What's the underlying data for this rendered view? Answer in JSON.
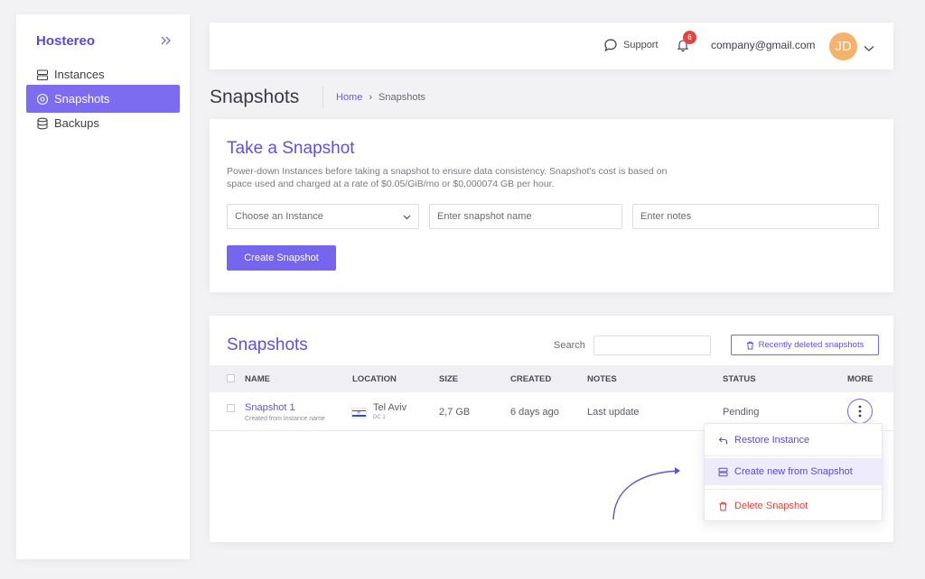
{
  "brand": "Hostereo",
  "sidebar": {
    "items": [
      {
        "label": "Instances",
        "icon": "server-icon",
        "active": false
      },
      {
        "label": "Snapshots",
        "icon": "disc-icon",
        "active": true
      },
      {
        "label": "Backups",
        "icon": "database-icon",
        "active": false
      }
    ]
  },
  "topbar": {
    "support_label": "Support",
    "notifications_count": "6",
    "email": "company@gmail.com",
    "avatar_initials": "JD"
  },
  "page": {
    "title": "Snapshots",
    "breadcrumb": {
      "home": "Home",
      "current": "Snapshots"
    }
  },
  "take_snapshot": {
    "title": "Take a Snapshot",
    "description": "Power-down Instances before taking a snapshot to ensure data consistency. Snapshot's cost is based on space used and charged at a rate of $0.05/GiB/mo or $0,000074 GB per hour.",
    "instance_select": "Choose an Instance",
    "name_placeholder": "Enter snapshot name",
    "notes_placeholder": "Enter notes",
    "create_button": "Create Snapshot"
  },
  "snapshots_table": {
    "title": "Snapshots",
    "search_label": "Search",
    "recently_deleted_button": "Recently deleted snapshots",
    "columns": {
      "name": "NAME",
      "location": "LOCATION",
      "size": "SIZE",
      "created": "CREATED",
      "notes": "NOTES",
      "status": "STATUS",
      "more": "MORE"
    },
    "rows": [
      {
        "name": "Snapshot 1",
        "subtitle": "Created from Instance name",
        "location": "Tel Aviv",
        "location_sub": "DC 1",
        "size": "2,7 GB",
        "created": "6 days ago",
        "notes": "Last update",
        "status": "Pending"
      }
    ]
  },
  "more_menu": {
    "restore": "Restore Instance",
    "create_new": "Create new from Snapshot",
    "delete": "Delete Snapshot"
  },
  "colors": {
    "accent": "#7665ee",
    "accent_text": "#6350d8",
    "danger": "#e0463d",
    "avatar": "#f4b26a"
  }
}
